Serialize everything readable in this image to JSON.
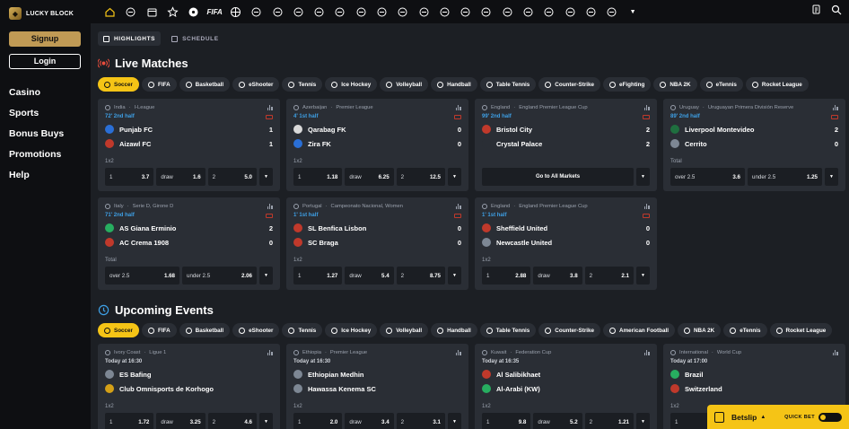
{
  "brand": {
    "name": "LUCKY BLOCK"
  },
  "sidebar": {
    "signup_label": "Signup",
    "login_label": "Login",
    "nav": [
      {
        "label": "Casino"
      },
      {
        "label": "Sports"
      },
      {
        "label": "Bonus Buys"
      },
      {
        "label": "Promotions"
      },
      {
        "label": "Help"
      }
    ]
  },
  "topbar": {
    "sport_icons": [
      "home-icon",
      "esports-icon",
      "calendar-icon",
      "star-icon",
      "soccer-icon",
      "fifa-icon",
      "basketball-icon",
      "running-icon",
      "tennis-icon",
      "baseball-icon",
      "volleyball-icon",
      "handball-icon",
      "table-tennis-icon",
      "hockey-icon",
      "football-icon",
      "rugby-icon",
      "cricket-icon",
      "cycling-icon",
      "gaming-icon",
      "darts-icon",
      "boxing-icon",
      "golf-icon",
      "motorsport-icon",
      "f1-icon",
      "snooker-icon",
      "more-icon"
    ],
    "fifa_label": "FIFA",
    "right_icons": [
      "betslip-history-icon",
      "search-icon"
    ]
  },
  "view_tabs": [
    {
      "label": "HIGHLIGHTS",
      "active": true
    },
    {
      "label": "SCHEDULE",
      "active": false
    }
  ],
  "live": {
    "title": "Live Matches",
    "filters": [
      {
        "label": "Soccer",
        "active": true
      },
      {
        "label": "FIFA"
      },
      {
        "label": "Basketball"
      },
      {
        "label": "eShooter"
      },
      {
        "label": "Tennis"
      },
      {
        "label": "Ice Hockey"
      },
      {
        "label": "Volleyball"
      },
      {
        "label": "Handball"
      },
      {
        "label": "Table Tennis"
      },
      {
        "label": "Counter-Strike"
      },
      {
        "label": "eFighting"
      },
      {
        "label": "NBA 2K"
      },
      {
        "label": "eTennis"
      },
      {
        "label": "Rocket League"
      }
    ],
    "cards": [
      {
        "country": "India",
        "league": "I-League",
        "time": "72' 2nd half",
        "home": "Punjab FC",
        "away": "Aizawl FC",
        "home_score": "1",
        "away_score": "1",
        "market": "1x2",
        "odds": [
          {
            "l": "1",
            "v": "3.7"
          },
          {
            "l": "draw",
            "v": "1.6"
          },
          {
            "l": "2",
            "v": "5.0"
          }
        ],
        "crest": [
          "#2a6fd6",
          "#c0392b"
        ]
      },
      {
        "country": "Azerbaijan",
        "league": "Premier League",
        "time": "4' 1st half",
        "home": "Qarabag FK",
        "away": "Zira FK",
        "home_score": "0",
        "away_score": "0",
        "market": "1x2",
        "odds": [
          {
            "l": "1",
            "v": "1.18"
          },
          {
            "l": "draw",
            "v": "6.25"
          },
          {
            "l": "2",
            "v": "12.5"
          }
        ],
        "crest": [
          "#d9d9d9",
          "#2a6fd6"
        ]
      },
      {
        "country": "England",
        "league": "England Premier League Cup",
        "time": "99' 2nd half",
        "home": "Bristol City",
        "away": "Crystal Palace",
        "home_score": "2",
        "away_score": "2",
        "market": "",
        "full_label": "Go to All Markets",
        "crest": [
          "#c0392b",
          "#2a2e35"
        ]
      },
      {
        "country": "Uruguay",
        "league": "Uruguayan Primera División Reserve",
        "time": "89' 2nd half",
        "home": "Liverpool Montevideo",
        "away": "Cerrito",
        "home_score": "2",
        "away_score": "0",
        "market": "Total",
        "odds": [
          {
            "l": "over 2.5",
            "v": "3.6"
          },
          {
            "l": "under 2.5",
            "v": "1.25"
          }
        ],
        "crest": [
          "#1f6f3f",
          "#7d8794"
        ]
      },
      {
        "country": "Italy",
        "league": "Serie D, Girone D",
        "time": "71' 2nd half",
        "home": "AS Giana Erminio",
        "away": "AC Crema 1908",
        "home_score": "2",
        "away_score": "0",
        "market": "Total",
        "odds": [
          {
            "l": "over 2.5",
            "v": "1.68"
          },
          {
            "l": "under 2.5",
            "v": "2.06"
          }
        ],
        "crest": [
          "#27ae60",
          "#c0392b"
        ]
      },
      {
        "country": "Portugal",
        "league": "Campeonato Nacional, Women",
        "time": "1' 1st half",
        "home": "SL Benfica Lisbon",
        "away": "SC Braga",
        "home_score": "0",
        "away_score": "0",
        "market": "1x2",
        "odds": [
          {
            "l": "1",
            "v": "1.27"
          },
          {
            "l": "draw",
            "v": "5.4"
          },
          {
            "l": "2",
            "v": "8.75"
          }
        ],
        "crest": [
          "#c0392b",
          "#c0392b"
        ]
      },
      {
        "country": "England",
        "league": "England Premier League Cup",
        "time": "1' 1st half",
        "home": "Sheffield United",
        "away": "Newcastle United",
        "home_score": "0",
        "away_score": "0",
        "market": "1x2",
        "odds": [
          {
            "l": "1",
            "v": "2.88"
          },
          {
            "l": "draw",
            "v": "3.8"
          },
          {
            "l": "2",
            "v": "2.1"
          }
        ],
        "crest": [
          "#c0392b",
          "#7d8794"
        ]
      }
    ]
  },
  "upcoming": {
    "title": "Upcoming Events",
    "filters": [
      {
        "label": "Soccer",
        "active": true
      },
      {
        "label": "FIFA"
      },
      {
        "label": "Basketball"
      },
      {
        "label": "eShooter"
      },
      {
        "label": "Tennis"
      },
      {
        "label": "Ice Hockey"
      },
      {
        "label": "Volleyball"
      },
      {
        "label": "Handball"
      },
      {
        "label": "Table Tennis"
      },
      {
        "label": "Counter-Strike"
      },
      {
        "label": "American Football"
      },
      {
        "label": "NBA 2K"
      },
      {
        "label": "eTennis"
      },
      {
        "label": "Rocket League"
      }
    ],
    "cards": [
      {
        "country": "Ivory Coast",
        "league": "Ligue 1",
        "time": "Today at 16:30",
        "home": "ES Bafing",
        "away": "Club Omnisports de Korhogo",
        "market": "1x2",
        "odds": [
          {
            "l": "1",
            "v": "1.72"
          },
          {
            "l": "draw",
            "v": "3.25"
          },
          {
            "l": "2",
            "v": "4.6"
          }
        ],
        "crest": [
          "#7d8794",
          "#d4a017"
        ]
      },
      {
        "country": "Ethiopia",
        "league": "Premier League",
        "time": "Today at 16:30",
        "home": "Ethiopian Medhin",
        "away": "Hawassa Kenema SC",
        "market": "1x2",
        "odds": [
          {
            "l": "1",
            "v": "2.0"
          },
          {
            "l": "draw",
            "v": "3.4"
          },
          {
            "l": "2",
            "v": "3.1"
          }
        ],
        "crest": [
          "#7d8794",
          "#7d8794"
        ]
      },
      {
        "country": "Kuwait",
        "league": "Federation Cup",
        "time": "Today at 16:35",
        "home": "Al Salibikhaet",
        "away": "Al-Arabi (KW)",
        "market": "1x2",
        "odds": [
          {
            "l": "1",
            "v": "9.8"
          },
          {
            "l": "draw",
            "v": "5.2"
          },
          {
            "l": "2",
            "v": "1.21"
          }
        ],
        "crest": [
          "#c0392b",
          "#27ae60"
        ]
      },
      {
        "country": "International",
        "league": "World Cup",
        "time": "Today at 17:00",
        "home": "Brazil",
        "away": "Switzerland",
        "market": "1x2",
        "odds": [
          {
            "l": "1",
            "v": ""
          }
        ],
        "crest": [
          "#27ae60",
          "#c0392b"
        ]
      }
    ]
  },
  "betslip": {
    "label": "Betslip",
    "quick_bet_label": "QUICK BET"
  }
}
